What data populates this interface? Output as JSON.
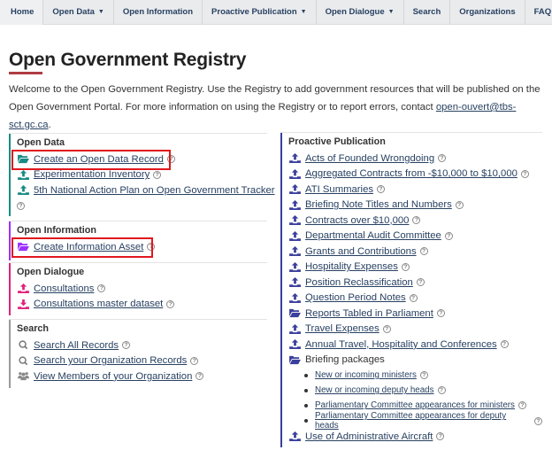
{
  "nav": {
    "items": [
      {
        "label": "Home",
        "dropdown": false
      },
      {
        "label": "Open Data",
        "dropdown": true
      },
      {
        "label": "Open Information",
        "dropdown": false
      },
      {
        "label": "Proactive Publication",
        "dropdown": true
      },
      {
        "label": "Open Dialogue",
        "dropdown": true
      },
      {
        "label": "Search",
        "dropdown": false
      },
      {
        "label": "Organizations",
        "dropdown": false
      },
      {
        "label": "FAQ",
        "dropdown": false
      }
    ],
    "caret_glyph": "⌄"
  },
  "page": {
    "title": "Open Government Registry",
    "intro_text": "Welcome to the Open Government Registry. Use the Registry to add government resources that will be published on the Open Government Portal. For more information on using the Registry or to report errors, contact ",
    "intro_link": "open-ouvert@tbs-sct.gc.ca",
    "intro_end": "."
  },
  "help_glyph": "?",
  "colors": {
    "open_data": "#1a8a84",
    "open_information": "#9b30ff",
    "open_dialogue": "#e0237d",
    "search": "#888888",
    "proactive": "#3b3f9c",
    "highlight": "#e0181e",
    "title_accent": "#af3c43",
    "link": "#284162"
  },
  "open_data": {
    "heading": "Open Data",
    "items": [
      {
        "label": "Create an Open Data Record",
        "icon": "folder-open-icon"
      },
      {
        "label": "Experimentation Inventory",
        "icon": "upload-icon"
      },
      {
        "label": "5th National Action Plan on Open Government Tracker",
        "icon": "upload-icon"
      }
    ]
  },
  "open_information": {
    "heading": "Open Information",
    "items": [
      {
        "label": "Create Information Asset",
        "icon": "folder-open-icon"
      }
    ]
  },
  "open_dialogue": {
    "heading": "Open Dialogue",
    "items": [
      {
        "label": "Consultations",
        "icon": "upload-icon"
      },
      {
        "label": "Consultations master dataset",
        "icon": "download-icon"
      }
    ]
  },
  "search": {
    "heading": "Search",
    "items": [
      {
        "label": "Search All Records",
        "icon": "search-icon"
      },
      {
        "label": "Search your Organization Records",
        "icon": "search-icon"
      },
      {
        "label": "View Members of your Organization",
        "icon": "users-icon"
      }
    ]
  },
  "proactive": {
    "heading": "Proactive Publication",
    "items": [
      {
        "label": "Acts of Founded Wrongdoing",
        "icon": "upload-icon"
      },
      {
        "label": "Aggregated Contracts from -$10,000 to $10,000",
        "icon": "upload-icon"
      },
      {
        "label": "ATI Summaries",
        "icon": "upload-icon"
      },
      {
        "label": "Briefing Note Titles and Numbers",
        "icon": "upload-icon"
      },
      {
        "label": "Contracts over $10,000",
        "icon": "upload-icon"
      },
      {
        "label": "Departmental Audit Committee",
        "icon": "upload-icon"
      },
      {
        "label": "Grants and Contributions",
        "icon": "upload-icon"
      },
      {
        "label": "Hospitality Expenses",
        "icon": "upload-icon"
      },
      {
        "label": "Position Reclassification",
        "icon": "upload-icon"
      },
      {
        "label": "Question Period Notes",
        "icon": "upload-icon"
      },
      {
        "label": "Reports Tabled in Parliament",
        "icon": "folder-open-icon"
      },
      {
        "label": "Travel Expenses",
        "icon": "upload-icon"
      },
      {
        "label": "Annual Travel, Hospitality and Conferences",
        "icon": "upload-icon"
      }
    ],
    "briefing": {
      "label": "Briefing packages",
      "icon": "folder-open-icon",
      "sub_items": [
        "New or incoming ministers",
        "New or incoming deputy heads",
        "Parliamentary Committee appearances for ministers",
        "Parliamentary Committee appearances for deputy heads"
      ]
    },
    "last_item": {
      "label": "Use of Administrative Aircraft",
      "icon": "upload-icon"
    }
  }
}
